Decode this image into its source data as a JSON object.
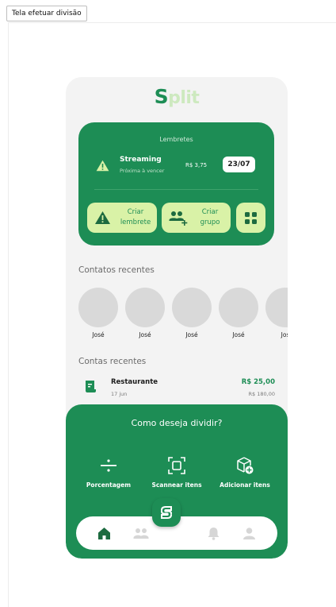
{
  "page_tab": {
    "label": "Tela efetuar divisão"
  },
  "app": {
    "logo_first": "S",
    "logo_rest": "plit"
  },
  "reminders": {
    "title": "Lembretes",
    "item": {
      "name": "Streaming",
      "subtitle": "Próxima à vencer",
      "value": "R$ 3,75",
      "date": "23/07"
    },
    "buttons": {
      "create_reminder_line1": "Criar",
      "create_reminder_line2": "lembrete",
      "create_group_line1": "Criar",
      "create_group_line2": "grupo"
    }
  },
  "recent_contacts": {
    "title": "Contatos recentes",
    "items": [
      {
        "name": "José"
      },
      {
        "name": "José"
      },
      {
        "name": "José"
      },
      {
        "name": "José"
      },
      {
        "name": "Jos"
      }
    ]
  },
  "recent_accounts": {
    "title": "Contas recentes",
    "items": [
      {
        "name": "Restaurante",
        "date": "17 jun",
        "amount": "R$ 25,00",
        "total": "R$ 180,00"
      }
    ]
  },
  "split_sheet": {
    "title": "Como deseja dividir?",
    "options": [
      {
        "label": "Porcentagem",
        "icon": "divide-icon"
      },
      {
        "label": "Scannear itens",
        "icon": "scan-icon"
      },
      {
        "label": "Adicionar itens",
        "icon": "box-add-icon"
      }
    ]
  },
  "navbar": {
    "items": [
      "home-icon",
      "group-icon",
      "split-icon",
      "bell-icon",
      "user-icon"
    ]
  },
  "colors": {
    "primary": "#1d8d55",
    "accent": "#d9f2a7",
    "background": "#f3f3f3"
  }
}
